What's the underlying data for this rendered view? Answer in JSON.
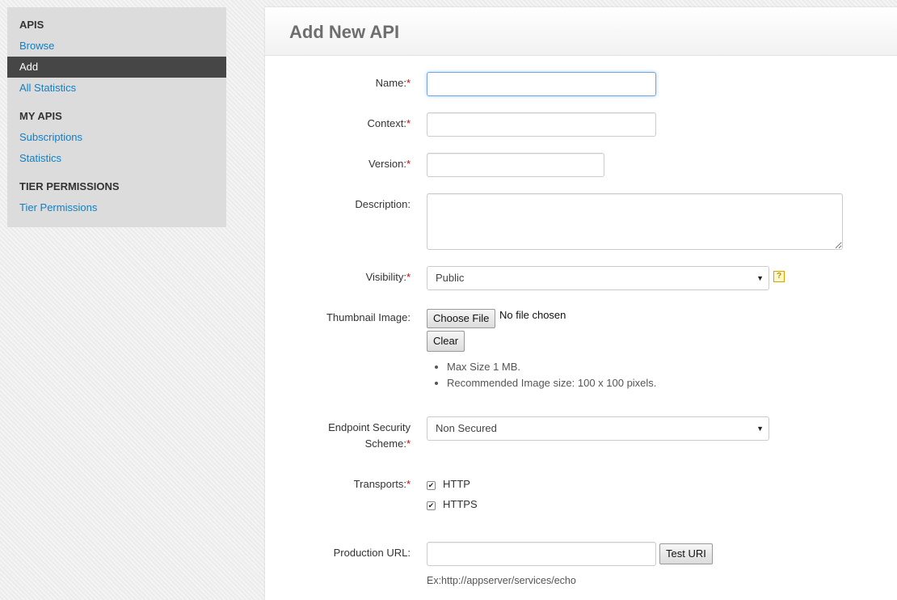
{
  "sidebar": {
    "sections": {
      "apis": {
        "header": "APIS",
        "browse": "Browse",
        "add": "Add",
        "all_statistics": "All Statistics"
      },
      "my_apis": {
        "header": "MY APIS",
        "subscriptions": "Subscriptions",
        "statistics": "Statistics"
      },
      "tier": {
        "header": "TIER PERMISSIONS",
        "tier_permissions": "Tier Permissions"
      }
    },
    "active_item": "Add"
  },
  "main": {
    "title": "Add New API",
    "required_marker": "*",
    "form": {
      "name": {
        "label": "Name:",
        "value": ""
      },
      "context": {
        "label": "Context:",
        "value": ""
      },
      "version": {
        "label": "Version:",
        "value": ""
      },
      "description": {
        "label": "Description:",
        "value": ""
      },
      "visibility": {
        "label": "Visibility:",
        "selected": "Public",
        "help": "?"
      },
      "thumbnail": {
        "label": "Thumbnail Image:",
        "choose_button": "Choose File",
        "no_file": "No file chosen",
        "clear_button": "Clear",
        "hints": [
          "Max Size 1 MB.",
          "Recommended Image size: 100 x 100 pixels."
        ]
      },
      "endpoint_security": {
        "label_line1": "Endpoint Security",
        "label_line2": "Scheme:",
        "selected": "Non Secured"
      },
      "transports": {
        "label": "Transports:",
        "options": [
          {
            "label": "HTTP",
            "checked": true
          },
          {
            "label": "HTTPS",
            "checked": true
          }
        ]
      },
      "production_url": {
        "label": "Production URL:",
        "value": "",
        "test_button": "Test URI",
        "example": "Ex:http://appserver/services/echo"
      }
    }
  },
  "colors": {
    "link": "#0f7fc7",
    "active_nav_bg": "#464646",
    "required": "#dd0000",
    "sidebar_bg": "#dcdcdc"
  },
  "icons": {
    "select_arrow": "triangle-down",
    "help": "question-mark-icon",
    "check": "check-mark"
  }
}
